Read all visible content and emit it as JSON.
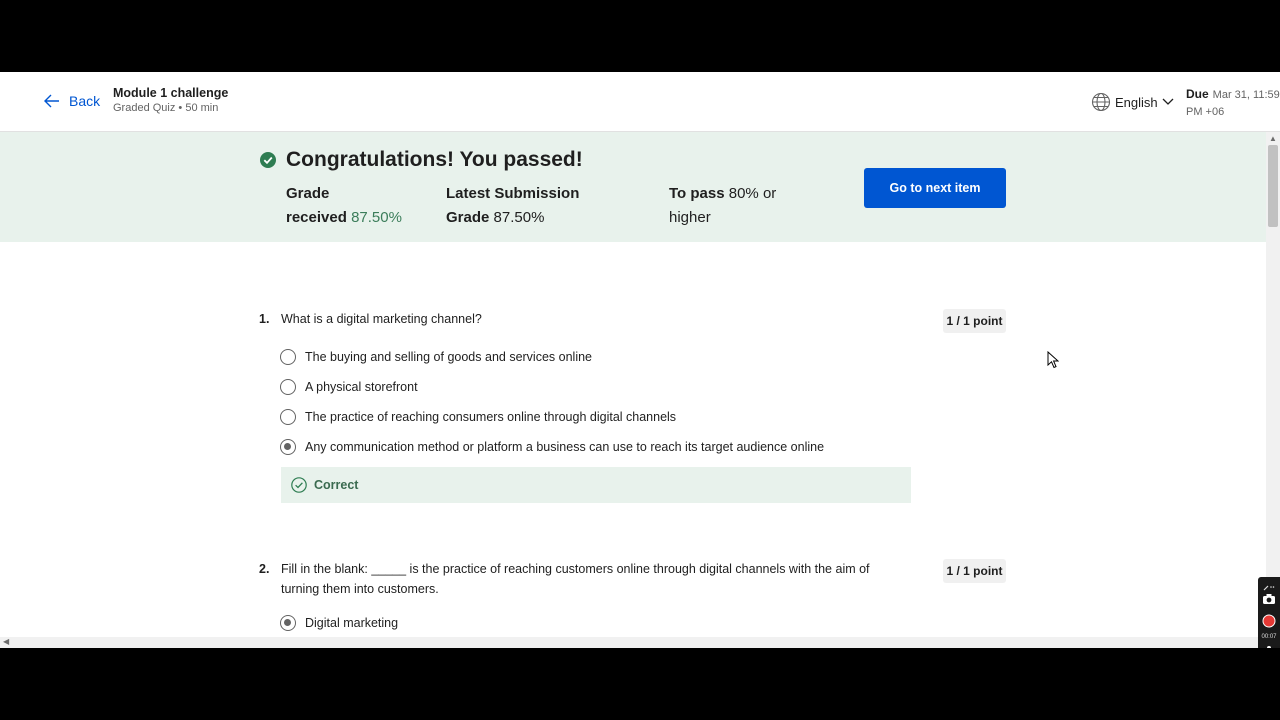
{
  "header": {
    "back_label": "Back",
    "title": "Module 1 challenge",
    "subtitle": "Graded Quiz • 50 min",
    "language": "English",
    "due_label": "Due",
    "due_value": "Mar 31, 11:59 PM +06"
  },
  "banner": {
    "heading": "Congratulations! You passed!",
    "grade_label_1": "Grade",
    "grade_label_2": "received",
    "grade_value": "87.50%",
    "latest_label_1": "Latest Submission",
    "latest_label_2": "Grade",
    "latest_value": "87.50%",
    "pass_label": "To pass",
    "pass_value": "80%",
    "pass_suffix_1": "or",
    "pass_suffix_2": "higher",
    "next_button": "Go to next item"
  },
  "questions": [
    {
      "number": "1.",
      "text": "What is a digital marketing channel?",
      "points": "1 / 1 point",
      "options": [
        {
          "label": " The buying and selling of goods and services online",
          "selected": false
        },
        {
          "label": "A physical storefront",
          "selected": false
        },
        {
          "label": "The practice of reaching consumers online through digital channels",
          "selected": false
        },
        {
          "label": "Any communication method or platform a business can use to reach its target audience online",
          "selected": true
        }
      ],
      "feedback": "Correct"
    },
    {
      "number": "2.",
      "text": "Fill in the blank: _____ is the practice of reaching customers online through digital channels with the aim of turning them into customers.",
      "points": "1 / 1 point",
      "options": [
        {
          "label": "Digital marketing",
          "selected": true
        }
      ]
    }
  ],
  "recorder": {
    "timer": "00:07"
  },
  "colors": {
    "accent": "#0056d2",
    "success_bg": "#e8f2ec",
    "success_text": "#3b7d5a"
  }
}
